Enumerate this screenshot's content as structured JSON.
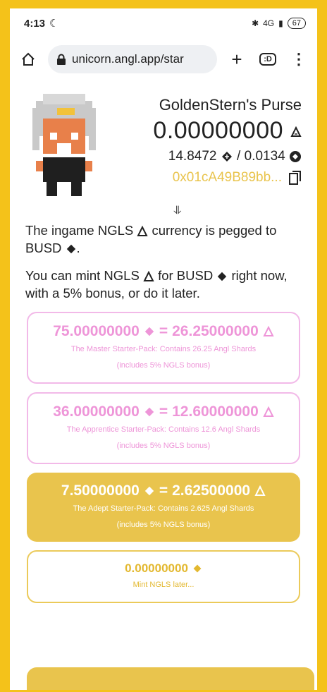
{
  "status": {
    "time": "4:13",
    "network": "4G",
    "battery": "67"
  },
  "browser": {
    "url": "unicorn.angl.app/star",
    "tabs_label": ":D"
  },
  "purse": {
    "title": "GoldenStern's Purse",
    "balance": "0.00000000",
    "busd_amount": "14.8472",
    "separator": " / ",
    "bnb_amount": "0.0134",
    "address": "0x01cA49B89bb..."
  },
  "arrow": "⥥",
  "info": {
    "para1_a": "The ingame NGLS",
    "para1_b": "currency is pegged to BUSD",
    "para2_a": "You can mint NGLS",
    "para2_b": "for BUSD",
    "para2_c": "right now, with a 5% bonus, or do it later."
  },
  "packs": [
    {
      "busd": "75.00000000",
      "ngls": "26.25000000",
      "desc": "The Master Starter-Pack: Contains 26.25 Angl Shards",
      "bonus": "(includes 5% NGLS bonus)"
    },
    {
      "busd": "36.00000000",
      "ngls": "12.60000000",
      "desc": "The Apprentice Starter-Pack: Contains 12.6 Angl Shards",
      "bonus": "(includes 5% NGLS bonus)"
    },
    {
      "busd": "7.50000000",
      "ngls": "2.62500000",
      "desc": "The Adept Starter-Pack: Contains 2.625 Angl Shards",
      "bonus": "(includes 5% NGLS bonus)"
    },
    {
      "busd": "0.00000000",
      "desc": "Mint NGLS later..."
    }
  ],
  "equals_sign": "=",
  "colors": {
    "accent_gold": "#e9c44d",
    "pink": "#ee95d8",
    "frame": "#f4c21a"
  },
  "icons": [
    "ngls-icon",
    "busd-icon",
    "bnb-icon",
    "copy-icon",
    "home-icon",
    "lock-icon",
    "plus-icon",
    "menu-icon"
  ]
}
